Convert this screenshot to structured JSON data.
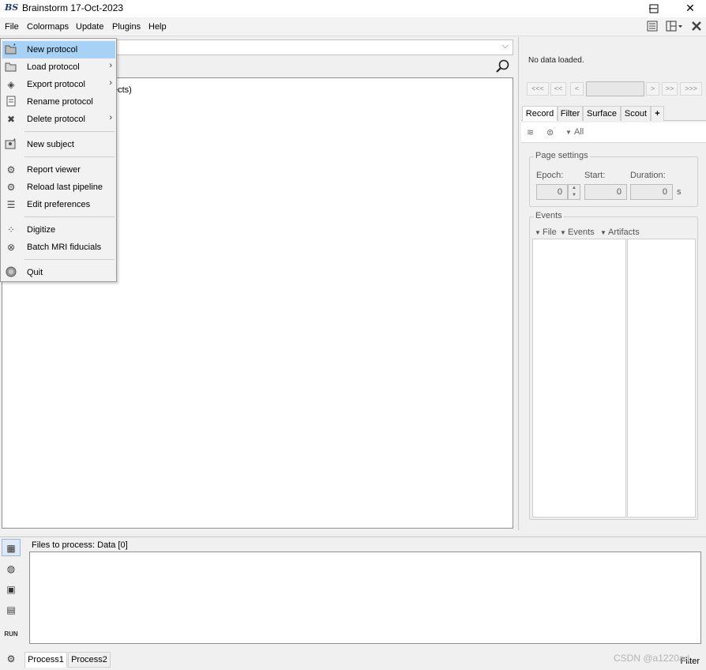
{
  "window": {
    "app_logo": "BS",
    "title": "Brainstorm 17-Oct-2023",
    "minimize_glyph": "─",
    "maximize_glyph": "☐",
    "close_glyph": "✕"
  },
  "menubar": {
    "items": [
      "File",
      "Colormaps",
      "Update",
      "Plugins",
      "Help"
    ],
    "toolbar_icons": [
      "preferences-icon",
      "layout-icon",
      "close-all-icon"
    ]
  },
  "explorer": {
    "protocol_value": "",
    "tree_partial_text": "ects)"
  },
  "file_menu": {
    "items": [
      {
        "label": "New protocol",
        "icon": "new-protocol-icon",
        "submenu": false,
        "selected": true
      },
      {
        "label": "Load protocol",
        "icon": "load-protocol-icon",
        "submenu": true
      },
      {
        "label": "Export protocol",
        "icon": "export-protocol-icon",
        "submenu": true
      },
      {
        "label": "Rename protocol",
        "icon": "rename-protocol-icon",
        "submenu": false
      },
      {
        "label": "Delete protocol",
        "icon": "delete-protocol-icon",
        "submenu": true
      },
      {
        "label": "New subject",
        "icon": "new-subject-icon",
        "submenu": false
      },
      {
        "label": "Report viewer",
        "icon": "report-viewer-icon",
        "submenu": false
      },
      {
        "label": "Reload last pipeline",
        "icon": "reload-pipeline-icon",
        "submenu": false
      },
      {
        "label": "Edit preferences",
        "icon": "preferences-icon",
        "submenu": false
      },
      {
        "label": "Digitize",
        "icon": "digitize-icon",
        "submenu": false
      },
      {
        "label": "Batch MRI fiducials",
        "icon": "batch-mri-icon",
        "submenu": false
      },
      {
        "label": "Quit",
        "icon": "quit-icon",
        "submenu": false
      }
    ]
  },
  "record_panel": {
    "no_data": "No data loaded.",
    "nav_buttons": [
      "<<<",
      "<<",
      "<",
      ">",
      ">>",
      ">>>"
    ],
    "tabs": [
      "Record",
      "Filter",
      "Surface",
      "Scout",
      "+"
    ],
    "active_tab": "Record",
    "channel_selector": "All",
    "page_settings": {
      "legend": "Page settings",
      "epoch_label": "Epoch:",
      "start_label": "Start:",
      "duration_label": "Duration:",
      "epoch_value": "0",
      "start_value": "0",
      "duration_value": "0",
      "unit": "s"
    },
    "events": {
      "legend": "Events",
      "menus": [
        "File",
        "Events",
        "Artifacts"
      ]
    }
  },
  "process_panel": {
    "files_label": "Files to process: Data [0]",
    "tabs": [
      "Process1",
      "Process2"
    ],
    "active_tab": "Process1",
    "filter_label": "Filter",
    "run_label": "RUN"
  },
  "watermark": "CSDN @a1220ad"
}
